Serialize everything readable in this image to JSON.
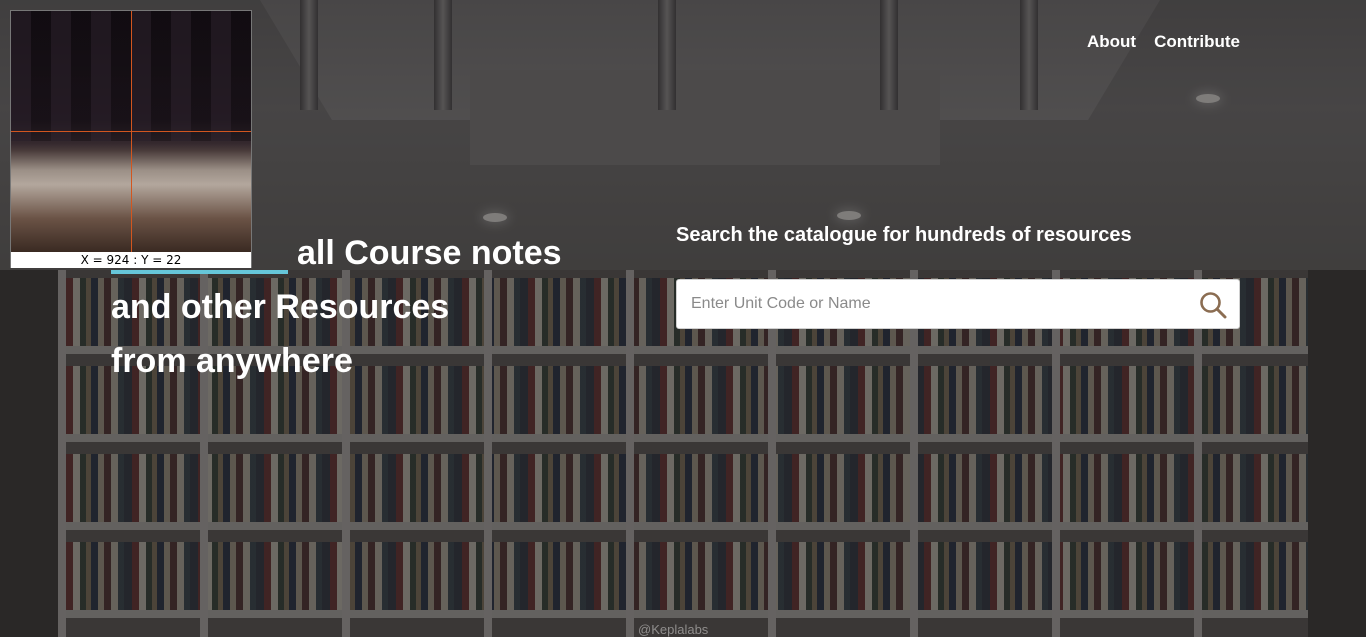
{
  "nav": {
    "about_label": "About",
    "contribute_label": "Contribute"
  },
  "hero": {
    "line1": "all Course notes",
    "line2": "and other Resources",
    "line3": "from anywhere",
    "accent_color": "#66c6d9"
  },
  "search": {
    "title": "Search the catalogue for hundreds of resources",
    "placeholder": "Enter Unit Code or Name",
    "icon": "search-icon",
    "icon_color": "#8b6d52"
  },
  "footer": {
    "credit": "@Keplalabs"
  },
  "magnifier": {
    "readout": "X = 924 : Y = 22",
    "crosshair_color": "#d2561f"
  }
}
